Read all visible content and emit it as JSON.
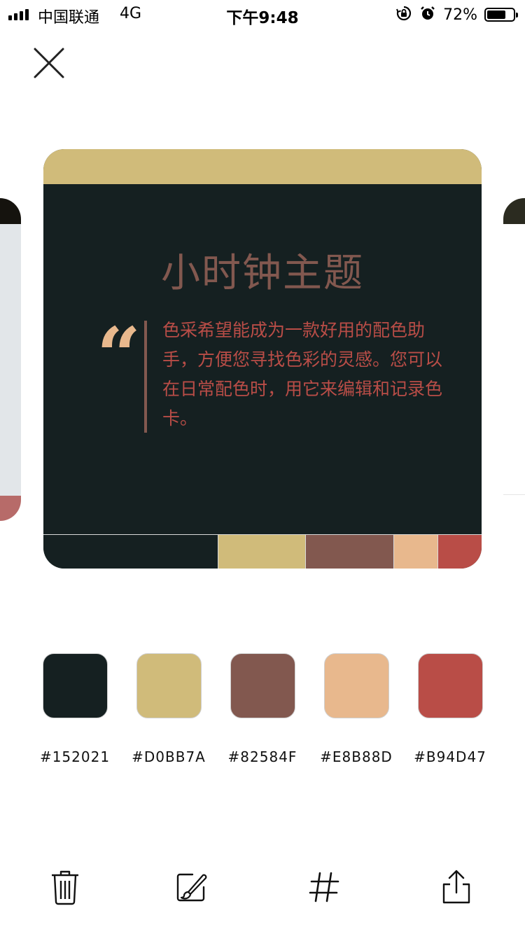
{
  "status_bar": {
    "carrier": "中国联通",
    "network": "4G",
    "time": "下午9:48",
    "battery_percent": "72%",
    "battery_level": 0.72
  },
  "card": {
    "title": "小时钟主题",
    "quote_mark": "“",
    "quote_text": "色采希望能成为一款好用的配色助手，方便您寻找色彩的灵感。您可以在日常配色时，用它来编辑和记录色卡。",
    "strip_colors": [
      "#152021",
      "#D0BB7A",
      "#82584F",
      "#E8B88D",
      "#B94D47"
    ],
    "strip_weights": [
      4,
      2,
      2,
      1,
      1
    ]
  },
  "palette": [
    {
      "hex": "#152021",
      "color": "#152021"
    },
    {
      "hex": "#D0BB7A",
      "color": "#D0BB7A"
    },
    {
      "hex": "#82584F",
      "color": "#82584F"
    },
    {
      "hex": "#E8B88D",
      "color": "#E8B88D"
    },
    {
      "hex": "#B94D47",
      "color": "#B94D47"
    }
  ],
  "toolbar": {
    "icons": [
      "trash-icon",
      "edit-brush-icon",
      "hash-icon",
      "share-icon"
    ]
  }
}
